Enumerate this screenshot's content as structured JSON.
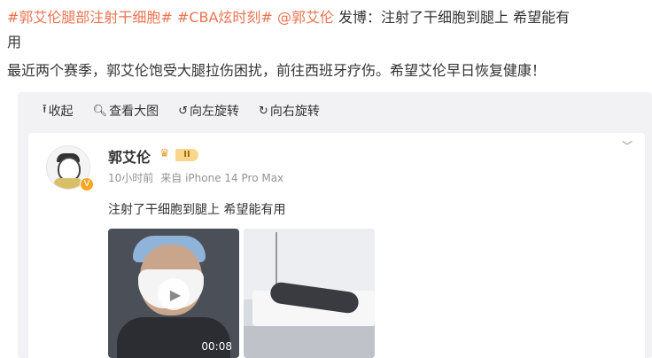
{
  "post": {
    "tag1": "#郭艾伦腿部注射干细胞#",
    "tag2": "#CBA炫时刻#",
    "mention": "@郭艾伦",
    "line1_rest": " 发博：注射了干细胞到腿上 希望能有",
    "line2": "用",
    "line3": "最近两个赛季，郭艾伦饱受大腿拉伤困扰，前往西班牙疗伤。希望艾伦早日恢复健康！"
  },
  "toolbar": {
    "collapse": "收起",
    "view_large": "查看大图",
    "rotate_left": "向左旋转",
    "rotate_right": "向右旋转"
  },
  "card": {
    "username": "郭艾伦",
    "vip_level": "II",
    "time": "10小时前",
    "source": "来自 iPhone 14 Pro Max",
    "text": "注射了干细胞到腿上 希望能有用",
    "video_duration": "00:08"
  },
  "colors": {
    "link": "#eb7350",
    "meta": "#939393",
    "box_bg": "#f2f2f5"
  },
  "icons": {
    "collapse": "arrow-up-icon",
    "view_large": "magnifier-icon",
    "rotate_left": "rotate-left-icon",
    "rotate_right": "rotate-right-icon",
    "menu": "chevron-down-icon",
    "play": "play-icon"
  }
}
